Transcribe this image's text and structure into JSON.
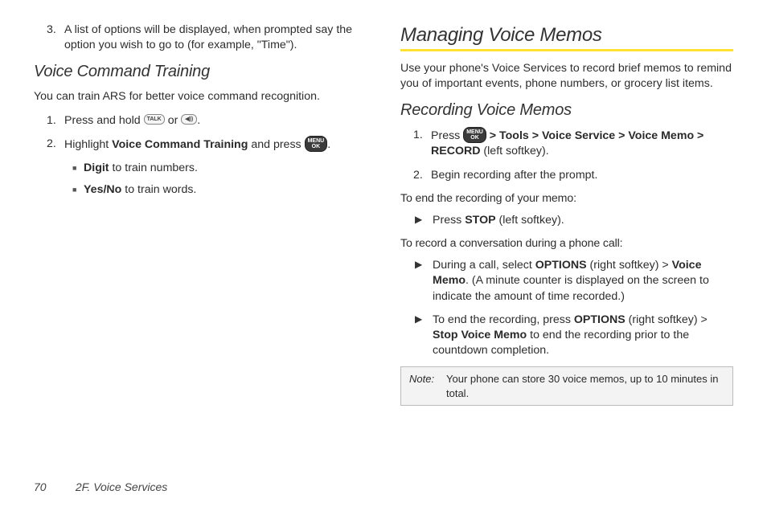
{
  "left": {
    "item3_num": "3.",
    "item3_text": "A list of options will be displayed, when prompted say the option you wish to go to (for example, \"Time\").",
    "h2_vct": "Voice Command Training",
    "vct_intro": "You can train ARS for better voice command recognition.",
    "step1_num": "1.",
    "step1_a": "Press and hold ",
    "step1_b": " or ",
    "step1_c": ".",
    "icon_talk": "TALK",
    "icon_speaker": "◀))",
    "step2_num": "2.",
    "step2_a": "Highlight ",
    "step2_bold": "Voice Command Training",
    "step2_b": " and press ",
    "step2_c": ".",
    "icon_menu": "MENU\nOK",
    "bul1_bold": "Digit",
    "bul1_text": " to train numbers.",
    "bul2_bold": "Yes/No",
    "bul2_text": " to train words."
  },
  "right": {
    "h1": "Managing Voice Memos",
    "intro": "Use your phone's Voice Services to record brief memos to remind you of important events, phone numbers, or grocery list items.",
    "h2_rec": "Recording Voice Memos",
    "step1_num": "1.",
    "step1_a": "Press ",
    "icon_menu": "MENU\nOK",
    "gt": " > ",
    "tools": "Tools",
    "voice_service": "Voice Service",
    "voice_memo": "Voice Memo",
    "record": "RECORD",
    "step1_end": " (left softkey).",
    "step2_num": "2.",
    "step2_text": "Begin recording after the prompt.",
    "lead_end": "To end the recording of your memo:",
    "ar1_a": "Press ",
    "ar1_bold": "STOP",
    "ar1_b": " (left softkey).",
    "lead_call": "To record a conversation during a phone call:",
    "ar2_a": "During a call, select ",
    "ar2_bold1": "OPTIONS",
    "ar2_b": " (right softkey) > ",
    "ar2_bold2": "Voice Memo",
    "ar2_c": ". (A minute counter is displayed on the screen to indicate the amount of time recorded.)",
    "ar3_a": "To end the recording, press ",
    "ar3_bold1": "OPTIONS",
    "ar3_b": " (right softkey) > ",
    "ar3_bold2": "Stop Voice Memo",
    "ar3_c": " to end the recording prior to the countdown completion.",
    "note_label": "Note:",
    "note_text": "Your phone can store 30 voice memos, up to 10 minutes in total."
  },
  "footer": {
    "page": "70",
    "section": "2F. Voice Services"
  }
}
